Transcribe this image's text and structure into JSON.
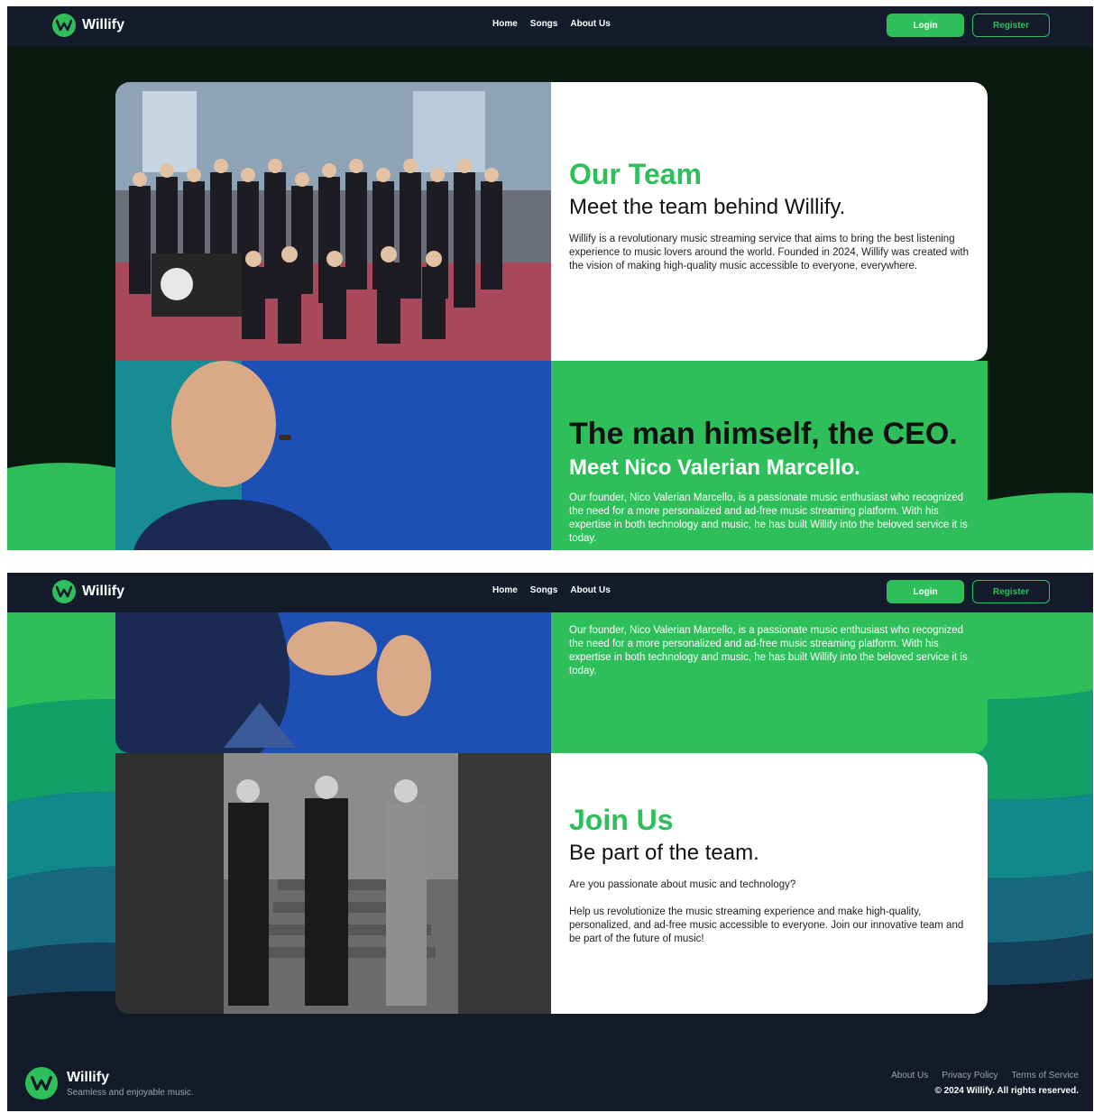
{
  "nav": {
    "brand": "Willify",
    "links": [
      "Home",
      "Songs",
      "About Us"
    ],
    "login_label": "Login",
    "register_label": "Register"
  },
  "team": {
    "title": "Our Team",
    "subtitle": "Meet the team behind Willify.",
    "body": "Willify is a revolutionary music streaming service that aims to bring the best listening experience to music lovers around the world. Founded in 2024, Willify was created with the vision of making high-quality music accessible to everyone, everywhere."
  },
  "ceo": {
    "title": "The man himself, the CEO.",
    "subtitle": "Meet Nico Valerian Marcello.",
    "body": "Our founder, Nico Valerian Marcello, is a passionate music enthusiast who recognized the need for a more personalized and ad-free music streaming platform. With his expertise in both technology and music, he has built Willify into the beloved service it is today."
  },
  "join": {
    "title": "Join Us",
    "subtitle": "Be part of the team.",
    "question": "Are you passionate about music and technology?",
    "body": "Help us revolutionize the music streaming experience and make high-quality, personalized, and ad-free music accessible to everyone. Join our innovative team and be part of the future of music!"
  },
  "footer": {
    "brand": "Willify",
    "tagline": "Seamless and enjoyable music.",
    "links": [
      "About Us",
      "Privacy Policy",
      "Terms of Service"
    ],
    "copyright": "© 2024 Willify. All rights reserved."
  },
  "colors": {
    "accent": "#2fbf5a",
    "nav_bg": "#141b2b",
    "footer_bg": "#131b29"
  },
  "icons": [
    "willify-logo-icon"
  ]
}
